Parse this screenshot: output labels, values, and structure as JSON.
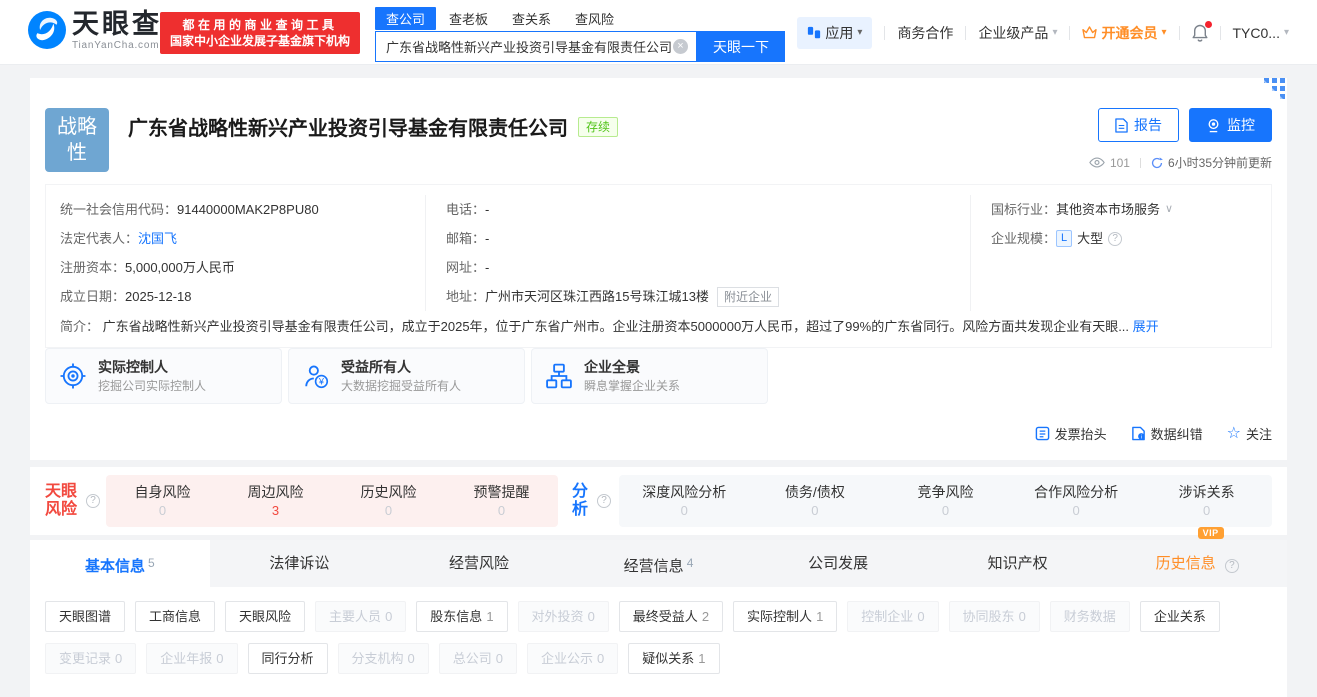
{
  "colors": {
    "brand_blue": "#1775fd",
    "logo_blue": "#0084ff",
    "badge_red": "#ee2f2f",
    "status_green": "#52c41a",
    "vip_orange": "#ff8e27",
    "risk_red": "#f2493f",
    "company_logo_bg": "#6fa6d2"
  },
  "icons": {
    "caret_down": "▾",
    "chevron_down": "∨",
    "star": "☆",
    "clear": "×",
    "help": "?"
  },
  "header": {
    "logo": {
      "brand": "天眼查",
      "domain": "TianYanCha.com"
    },
    "slogan": {
      "line1": "都在用的商业查询工具",
      "line2": "国家中小企业发展子基金旗下机构"
    },
    "search_tabs": [
      {
        "label": "查公司"
      },
      {
        "label": "查老板"
      },
      {
        "label": "查关系"
      },
      {
        "label": "查风险"
      }
    ],
    "search": {
      "value": "广东省战略性新兴产业投资引导基金有限责任公司",
      "button": "天眼一下"
    },
    "nav": {
      "apps": "应用",
      "cooperation": "商务合作",
      "enterprise": "企业级产品",
      "vip": "开通会员",
      "user": "TYC0..."
    }
  },
  "company": {
    "logo_line1": "战略",
    "logo_line2": "性",
    "name": "广东省战略性新兴产业投资引导基金有限责任公司",
    "status": "存续",
    "report_button": "报告",
    "monitor_button": "监控",
    "views": "101",
    "updated": "6小时35分钟前更新",
    "fields": {
      "col1": [
        {
          "label": "统一社会信用代码：",
          "value": "91440000MAK2P8PU80"
        },
        {
          "label": "法定代表人：",
          "value": "沈国飞"
        },
        {
          "label": "注册资本：",
          "value": "5,000,000万人民币"
        },
        {
          "label": "成立日期：",
          "value": "2025-12-18"
        }
      ],
      "col2": [
        {
          "label": "电话：",
          "value": "-"
        },
        {
          "label": "邮箱：",
          "value": "-"
        },
        {
          "label": "网址：",
          "value": "-"
        },
        {
          "label": "地址：",
          "value": "广州市天河区珠江西路15号珠江城13楼",
          "tag": "附近企业"
        }
      ],
      "col3": [
        {
          "label": "国标行业：",
          "value": "其他资本市场服务"
        },
        {
          "label": "企业规模：",
          "badge": "L",
          "value": "大型"
        }
      ]
    },
    "intro": {
      "label": "简介：",
      "text": "广东省战略性新兴产业投资引导基金有限责任公司，成立于2025年，位于广东省广州市。企业注册资本5000000万人民币，超过了99%的广东省同行。风险方面共发现企业有天眼...",
      "expand": "展开"
    },
    "feature_cards": [
      {
        "title": "实际控制人",
        "desc": "挖掘公司实际控制人"
      },
      {
        "title": "受益所有人",
        "desc": "大数据挖掘受益所有人"
      },
      {
        "title": "企业全景",
        "desc": "瞬息掌握企业关系"
      }
    ],
    "footer_links": [
      {
        "label": "发票抬头"
      },
      {
        "label": "数据纠错"
      },
      {
        "label": "关注"
      }
    ]
  },
  "risk": {
    "left_title": "天眼风险",
    "pink_items": [
      {
        "label": "自身风险",
        "count": "0"
      },
      {
        "label": "周边风险",
        "count": "3"
      },
      {
        "label": "历史风险",
        "count": "0"
      },
      {
        "label": "预警提醒",
        "count": "0"
      }
    ],
    "mid_title": "分析",
    "gray_items": [
      {
        "label": "深度风险分析",
        "count": "0"
      },
      {
        "label": "债务/债权",
        "count": "0"
      },
      {
        "label": "竞争风险",
        "count": "0"
      },
      {
        "label": "合作风险分析",
        "count": "0"
      },
      {
        "label": "涉诉关系",
        "count": "0"
      }
    ]
  },
  "tabs": [
    {
      "label": "基本信息",
      "count": "5"
    },
    {
      "label": "法律诉讼"
    },
    {
      "label": "经营风险"
    },
    {
      "label": "经营信息",
      "count": "4"
    },
    {
      "label": "公司发展"
    },
    {
      "label": "知识产权"
    },
    {
      "label": "历史信息",
      "vip": "VIP"
    }
  ],
  "chips": {
    "row1": [
      {
        "label": "天眼图谱"
      },
      {
        "label": "工商信息"
      },
      {
        "label": "天眼风险"
      },
      {
        "label": "主要人员",
        "count": "0"
      },
      {
        "label": "股东信息",
        "count": "1"
      },
      {
        "label": "对外投资",
        "count": "0"
      },
      {
        "label": "最终受益人",
        "count": "2"
      },
      {
        "label": "实际控制人",
        "count": "1"
      },
      {
        "label": "控制企业",
        "count": "0"
      },
      {
        "label": "协同股东",
        "count": "0"
      },
      {
        "label": "财务数据"
      },
      {
        "label": "企业关系"
      }
    ],
    "row2": [
      {
        "label": "变更记录",
        "count": "0"
      },
      {
        "label": "企业年报",
        "count": "0"
      },
      {
        "label": "同行分析"
      },
      {
        "label": "分支机构",
        "count": "0"
      },
      {
        "label": "总公司",
        "count": "0"
      },
      {
        "label": "企业公示",
        "count": "0"
      },
      {
        "label": "疑似关系",
        "count": "1"
      }
    ]
  }
}
